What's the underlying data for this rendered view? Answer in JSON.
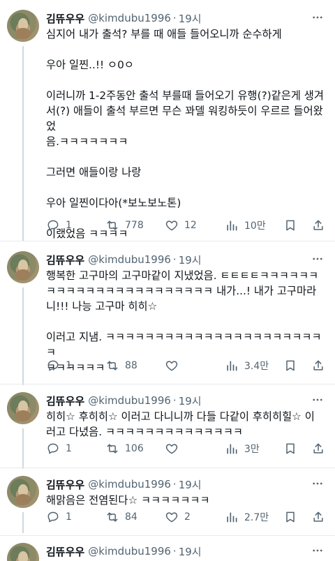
{
  "tweets": [
    {
      "name": "김뜌우우",
      "handle": "@kimdubu1996",
      "time": "19시",
      "text": "심지어 내가 출석? 부를 때 애들 들어오니까 순수하게\n\n우아 일찐..!! ㅇ0ㅇ\n\n이러니까 1-2주동안 출석 부를때 들어오기 유행(?)같은게 생겨\n서(?) 애들이 출석 부르면 무슨 꽈델 워킹하듯이 우르르 들어왔었\n음.ㅋㅋㅋㅋㅋㅋㅋ\n\n그러면 애들이랑 나랑\n\n우아 일찐이다아(*보노보노톤)\n\n이랬었음 ㅋㅋㅋㅋ",
      "replies": "1",
      "retweets": "778",
      "likes": "12",
      "views": "10만"
    },
    {
      "name": "김뜌우우",
      "handle": "@kimdubu1996",
      "time": "19시",
      "text": "행복한 고구마의 고구마같이 지냈었음. ㅌㅌㅌㅌㅋㅋㅋㅋㅋㅋ\nㅋㅋㅋㅋㅋㅋㅋㅋㅋㅋㅋㅋㅋㅋㅋㅋㅋ 내가...! 내가 고구마라\n니!!! 나능 고구마 히히☆\n\n이러고 지냄. ㅋㅋㅋㅋㅋㅋㅋㅋㅋㅋㅋㅋㅋㅋㅋㅋㅋㅋㅋㅋㅋㅋㅋ\nㅋㅋㅋㅋㅋㅋ",
      "replies": "1",
      "retweets": "88",
      "likes": "",
      "views": "3.4만"
    },
    {
      "name": "김뜌우우",
      "handle": "@kimdubu1996",
      "time": "19시",
      "text": "히히☆ 후히히☆ 이러고 다니니까 다들 다같이 후히히힐☆ 이\n러고 다녔음. ㅋㅋㅋㅋㅋㅋㅋㅋㅋㅋㅋㅋㅋㅋ",
      "replies": "1",
      "retweets": "106",
      "likes": "",
      "views": "3만"
    },
    {
      "name": "김뜌우우",
      "handle": "@kimdubu1996",
      "time": "19시",
      "text": "해맑음은 전염된다☆ ㅋㅋㅋㅋㅋㅋㅋ",
      "replies": "1",
      "retweets": "84",
      "likes": "2",
      "views": "2.7만"
    },
    {
      "name": "김뜌우우",
      "handle": "@kimdubu1996",
      "time": "19시",
      "text": "",
      "replies": "",
      "retweets": "",
      "likes": "",
      "views": ""
    }
  ],
  "colors": {
    "text": "#0f1419",
    "muted": "#536471",
    "divider": "#e6e9ec",
    "thread": "#cfd9de"
  },
  "icons": [
    "more-icon",
    "reply-icon",
    "retweet-icon",
    "like-icon",
    "views-icon",
    "bookmark-icon",
    "share-icon"
  ]
}
